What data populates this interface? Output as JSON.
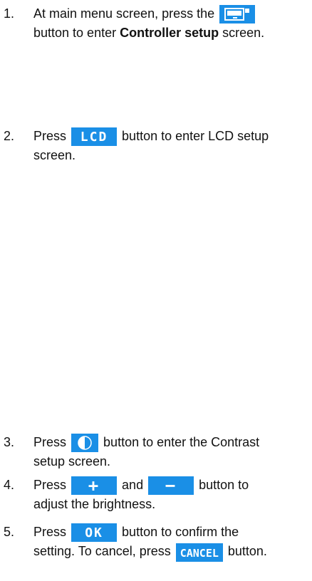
{
  "steps": [
    {
      "number": "1.",
      "text_before": "At main menu screen, press the",
      "button_icon": "controller-icon",
      "text_line2_before": "button to enter ",
      "text_bold": "Controller setup",
      "text_after": " screen."
    },
    {
      "number": "2.",
      "text_before": "Press",
      "button_label": "LCD",
      "text_after": "button to enter LCD setup",
      "text_line2": "screen."
    },
    {
      "number": "3.",
      "text_before": "Press",
      "button_icon": "contrast-icon",
      "text_after": "button to enter the Contrast",
      "text_line2": "setup screen."
    },
    {
      "number": "4.",
      "text_before": "Press",
      "button1_label": "+",
      "text_mid": "and",
      "button2_label": "−",
      "text_after": "button to",
      "text_line2": "adjust the brightness."
    },
    {
      "number": "5.",
      "text_before": "Press",
      "button_label": "OK",
      "text_after": "button to confirm the",
      "text_line2_before": "setting. To cancel, press",
      "cancel_label": "CANCEL",
      "text_line2_after": "button."
    }
  ],
  "colors": {
    "button": "#1a8fe6",
    "text": "#111111"
  }
}
